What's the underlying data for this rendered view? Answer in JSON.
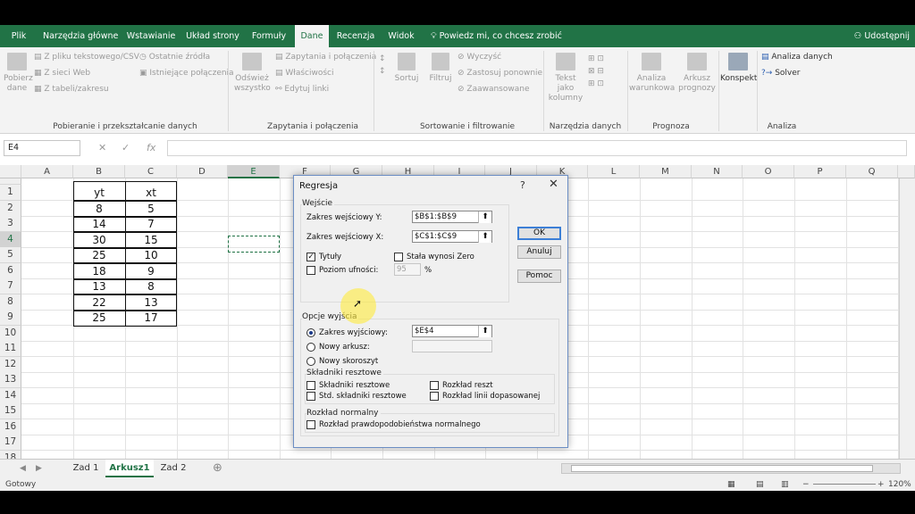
{
  "tabs": [
    "Plik",
    "Narzędzia główne",
    "Wstawianie",
    "Układ strony",
    "Formuły",
    "Dane",
    "Recenzja",
    "Widok"
  ],
  "tell_me": "Powiedz mi, co chcesz zrobić",
  "share": "Udostępnij",
  "ribbon": {
    "get_data": "Pobierz dane",
    "from_text": "Z pliku tekstowego/CSV",
    "from_web": "Z sieci Web",
    "from_table": "Z tabeli/zakresu",
    "recent_sources": "Ostatnie źródła",
    "existing_conn": "Istniejące połączenia",
    "group_get": "Pobieranie i przekształcanie danych",
    "refresh_all": "Odśwież wszystko",
    "queries_conn": "Zapytania i połączenia",
    "properties": "Właściwości",
    "edit_links": "Edytuj linki",
    "group_queries": "Zapytania i połączenia",
    "sort": "Sortuj",
    "filter": "Filtruj",
    "clear": "Wyczyść",
    "reapply": "Zastosuj ponownie",
    "advanced": "Zaawansowane",
    "group_sort": "Sortowanie i filtrowanie",
    "text_to_columns": "Tekst jako kolumny",
    "group_tools": "Narzędzia danych",
    "whatif": "Analiza warunkowa",
    "forecast_sheet": "Arkusz prognozy",
    "group_forecast": "Prognoza",
    "outline": "Konspekt",
    "data_analysis": "Analiza danych",
    "solver": "Solver",
    "group_analysis": "Analiza"
  },
  "namebox": "E4",
  "columns": [
    "A",
    "B",
    "C",
    "D",
    "E",
    "F",
    "G",
    "H",
    "I",
    "J",
    "K",
    "L",
    "M",
    "N",
    "O",
    "P",
    "Q"
  ],
  "rows": [
    "1",
    "2",
    "3",
    "4",
    "5",
    "6",
    "7",
    "8",
    "9",
    "10",
    "11",
    "12",
    "13",
    "14",
    "15",
    "16",
    "17",
    "18"
  ],
  "table": {
    "headers": [
      "yt",
      "xt"
    ],
    "y": [
      "8",
      "14",
      "30",
      "25",
      "18",
      "13",
      "22",
      "25"
    ],
    "x": [
      "5",
      "7",
      "15",
      "10",
      "9",
      "8",
      "13",
      "17"
    ]
  },
  "sheet_tabs": [
    "Zad 1",
    "Arkusz1",
    "Zad 2"
  ],
  "status": "Gotowy",
  "zoom": "120%",
  "dialog": {
    "title": "Regresja",
    "help": "?",
    "close": "✕",
    "input_group": "Wejście",
    "input_y_label": "Zakres wejściowy Y:",
    "input_y_value": "$B$1:$B$9",
    "input_x_label": "Zakres wejściowy X:",
    "input_x_value": "$C$1:$C$9",
    "labels": "Tytuły",
    "const_zero": "Stała wynosi Zero",
    "confidence": "Poziom ufności:",
    "confidence_value": "95",
    "percent": "%",
    "output_group": "Opcje wyjścia",
    "output_range": "Zakres wyjściowy:",
    "output_range_value": "$E$4",
    "new_sheet": "Nowy arkusz:",
    "new_workbook": "Nowy skoroszyt",
    "residuals_group": "Składniki resztowe",
    "residuals": "Składniki resztowe",
    "std_residuals": "Std. składniki resztowe",
    "residual_plots": "Rozkład reszt",
    "line_fit": "Rozkład linii dopasowanej",
    "normal_group": "Rozkład normalny",
    "normal_prob": "Rozkład prawdopodobieństwa normalnego",
    "ok": "OK",
    "cancel": "Anuluj",
    "help_btn": "Pomoc"
  }
}
